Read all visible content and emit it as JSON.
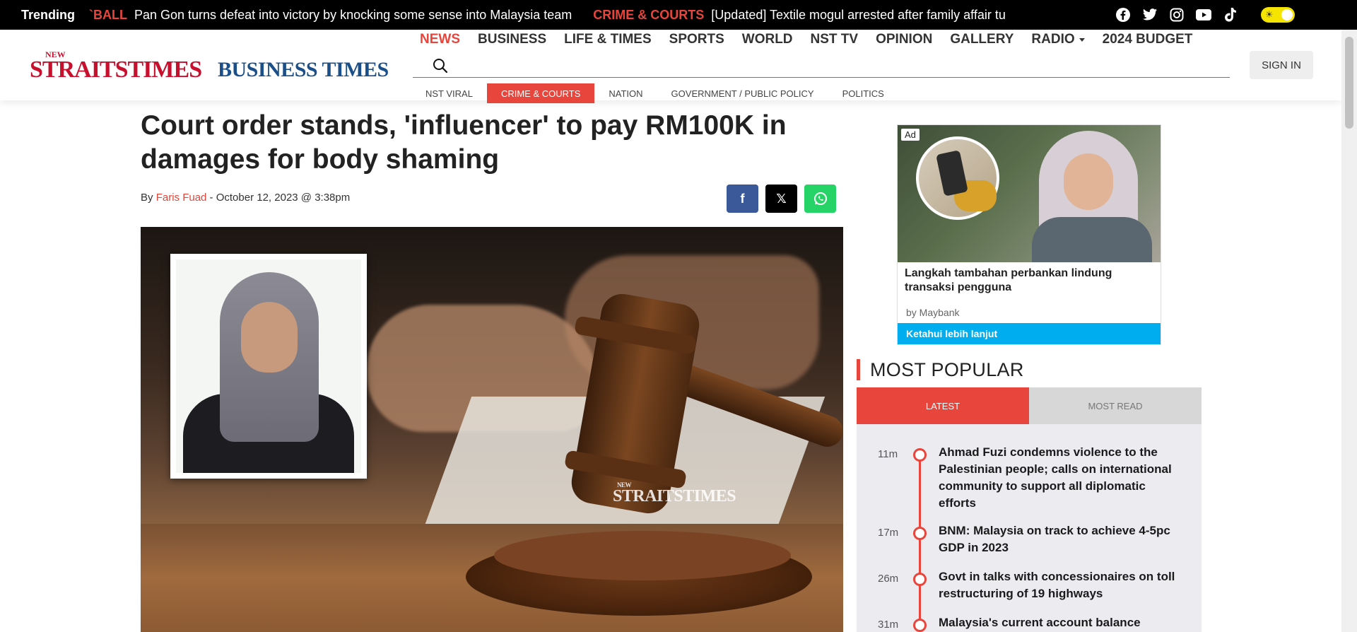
{
  "trending": {
    "label": "Trending",
    "items": [
      {
        "category": "`BALL",
        "headline": "Pan Gon turns defeat into victory by knocking some sense into Malaysia team"
      },
      {
        "category": "CRIME & COURTS",
        "headline": "[Updated] Textile mogul arrested after family affair tu"
      }
    ],
    "social_icons": [
      "facebook-icon",
      "twitter-icon",
      "instagram-icon",
      "youtube-icon",
      "tiktok-icon"
    ],
    "theme_toggle_icon": "☀"
  },
  "header": {
    "logo_nst_small": "NEW",
    "logo_nst": "STRAITSTIMES",
    "logo_bt": "BUSINESS TIMES",
    "nav": [
      {
        "label": "NEWS",
        "active": true
      },
      {
        "label": "BUSINESS"
      },
      {
        "label": "LIFE & TIMES"
      },
      {
        "label": "SPORTS"
      },
      {
        "label": "WORLD"
      },
      {
        "label": "NST TV"
      },
      {
        "label": "OPINION"
      },
      {
        "label": "GALLERY"
      },
      {
        "label": "RADIO",
        "dropdown": true
      },
      {
        "label": "2024 BUDGET"
      }
    ],
    "search_placeholder": "",
    "signin_label": "SIGN IN",
    "subnav": [
      {
        "label": "NST VIRAL"
      },
      {
        "label": "CRIME & COURTS",
        "active": true
      },
      {
        "label": "NATION"
      },
      {
        "label": "GOVERNMENT / PUBLIC POLICY"
      },
      {
        "label": "POLITICS"
      }
    ]
  },
  "article": {
    "title": "Court order stands, 'influencer' to pay RM100K in damages for body shaming",
    "by": "By ",
    "author": "Faris Fuad",
    "date": " - October 12, 2023 @ 3:38pm",
    "share": {
      "facebook": "f",
      "x": "𝕏",
      "whatsapp": "✆"
    },
    "image_watermark_small": "NEW",
    "image_watermark": "STRAITSTIMES"
  },
  "ad": {
    "badge": "Ad",
    "headline": "Langkah tambahan perbankan lindung transaksi pengguna",
    "sponsor": "by Maybank",
    "cta": "Ketahui lebih lanjut"
  },
  "most_popular": {
    "title": "MOST POPULAR",
    "tabs": [
      {
        "label": "LATEST",
        "active": true
      },
      {
        "label": "MOST READ"
      }
    ],
    "items": [
      {
        "time": "11m",
        "title": "Ahmad Fuzi condemns violence to the Palestinian people; calls on international community to support all diplomatic efforts"
      },
      {
        "time": "17m",
        "title": "BNM: Malaysia on track to achieve 4-5pc GDP in 2023"
      },
      {
        "time": "26m",
        "title": "Govt in talks with concessionaires on toll restructuring of 19 highways"
      },
      {
        "time": "31m",
        "title": "Malaysia's current account balance"
      }
    ]
  },
  "colors": {
    "accent": "#e8453c",
    "brand_nst": "#c8102e",
    "brand_bt": "#1b4f8a",
    "facebook": "#3b5998",
    "whatsapp": "#25d366",
    "ad_cta": "#00aeef"
  }
}
